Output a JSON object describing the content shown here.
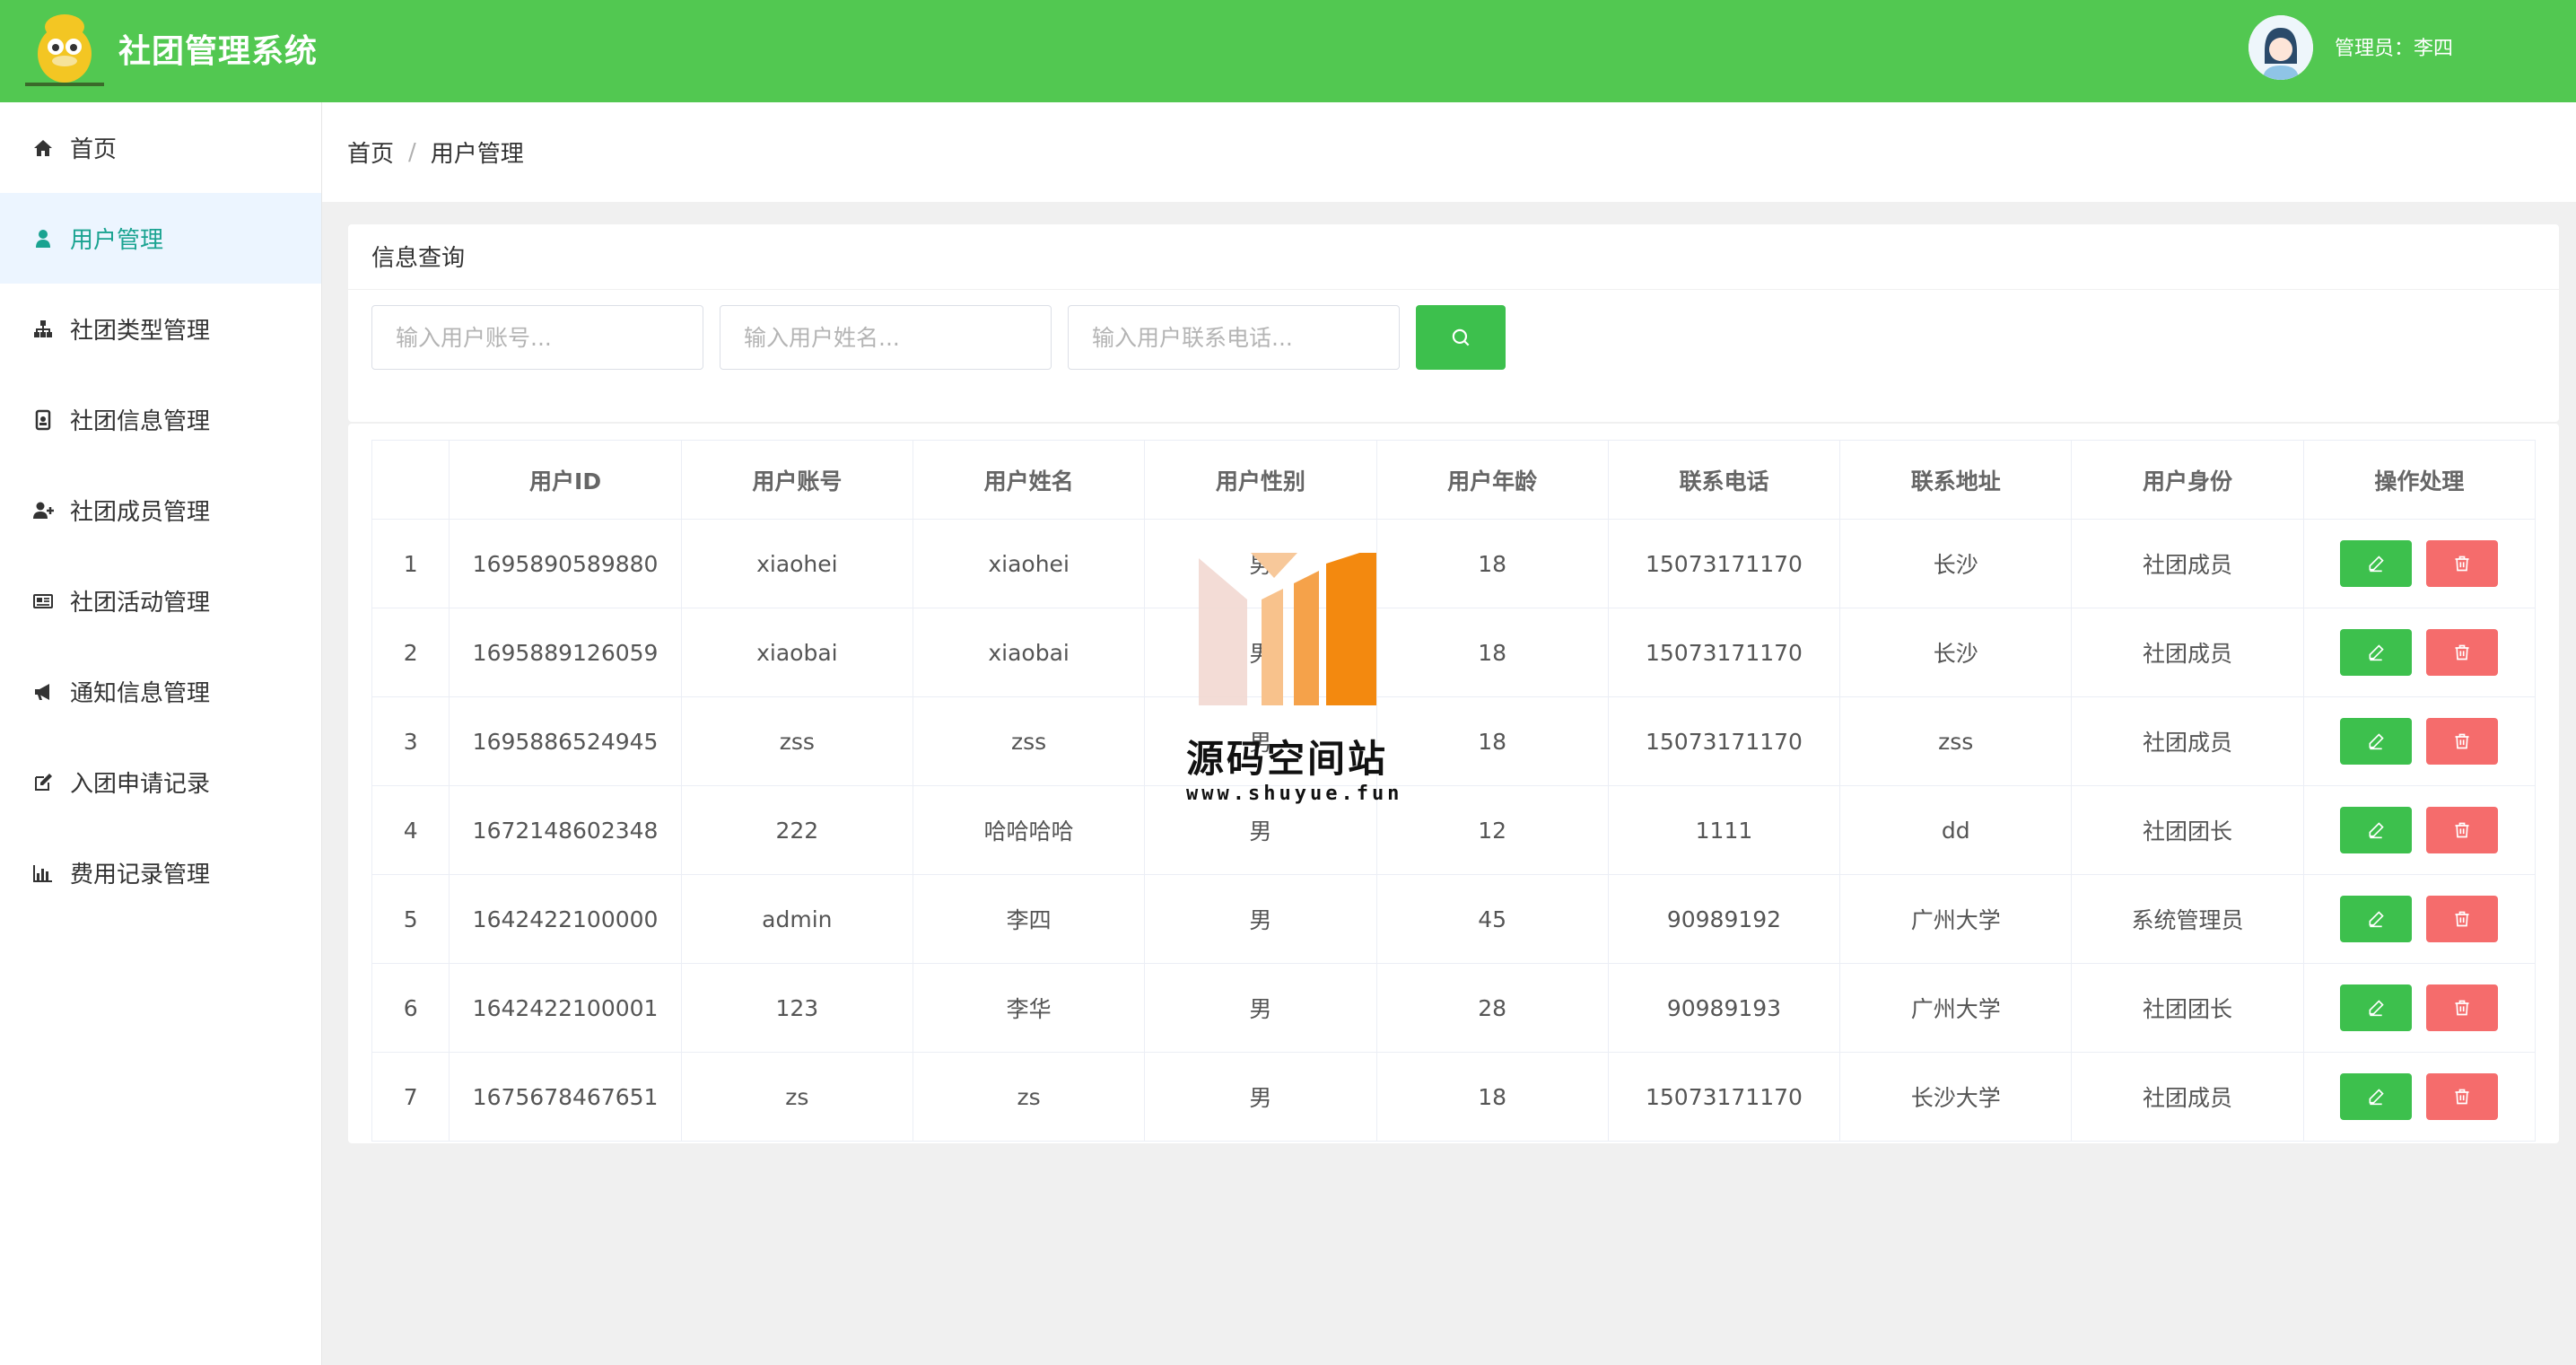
{
  "header": {
    "title": "社团管理系统",
    "admin_label": "管理员：李四"
  },
  "sidebar": {
    "items": [
      {
        "label": "首页",
        "icon": "home-icon"
      },
      {
        "label": "用户管理",
        "icon": "user-icon",
        "active": true
      },
      {
        "label": "社团类型管理",
        "icon": "sitemap-icon"
      },
      {
        "label": "社团信息管理",
        "icon": "id-badge-icon"
      },
      {
        "label": "社团成员管理",
        "icon": "user-plus-icon"
      },
      {
        "label": "社团活动管理",
        "icon": "newspaper-icon"
      },
      {
        "label": "通知信息管理",
        "icon": "bullhorn-icon"
      },
      {
        "label": "入团申请记录",
        "icon": "edit-icon"
      },
      {
        "label": "费用记录管理",
        "icon": "bar-chart-icon"
      }
    ]
  },
  "breadcrumb": {
    "home": "首页",
    "separator": "/",
    "current": "用户管理"
  },
  "search": {
    "title": "信息查询",
    "account_placeholder": "输入用户账号...",
    "name_placeholder": "输入用户姓名...",
    "phone_placeholder": "输入用户联系电话..."
  },
  "table": {
    "headers": [
      "",
      "用户ID",
      "用户账号",
      "用户姓名",
      "用户性别",
      "用户年龄",
      "联系电话",
      "联系地址",
      "用户身份",
      "操作处理"
    ],
    "rows": [
      [
        "1",
        "1695890589880",
        "xiaohei",
        "xiaohei",
        "男",
        "18",
        "15073171170",
        "长沙",
        "社团成员"
      ],
      [
        "2",
        "1695889126059",
        "xiaobai",
        "xiaobai",
        "男",
        "18",
        "15073171170",
        "长沙",
        "社团成员"
      ],
      [
        "3",
        "1695886524945",
        "zss",
        "zss",
        "男",
        "18",
        "15073171170",
        "zss",
        "社团成员"
      ],
      [
        "4",
        "1672148602348",
        "222",
        "哈哈哈哈",
        "男",
        "12",
        "1111",
        "dd",
        "社团团长"
      ],
      [
        "5",
        "1642422100000",
        "admin",
        "李四",
        "男",
        "45",
        "90989192",
        "广州大学",
        "系统管理员"
      ],
      [
        "6",
        "1642422100001",
        "123",
        "李华",
        "男",
        "28",
        "90989193",
        "广州大学",
        "社团团长"
      ],
      [
        "7",
        "1675678467651",
        "zs",
        "zs",
        "男",
        "18",
        "15073171170",
        "长沙大学",
        "社团成员"
      ]
    ]
  },
  "watermark": {
    "text": "源码空间站",
    "url": "www.shuyue.fun"
  },
  "colors": {
    "header_bg": "#52c851",
    "active_text": "#1aa391",
    "active_bg": "#ecf5ff",
    "edit_btn": "#3dc04d",
    "delete_btn": "#f56c6c"
  }
}
